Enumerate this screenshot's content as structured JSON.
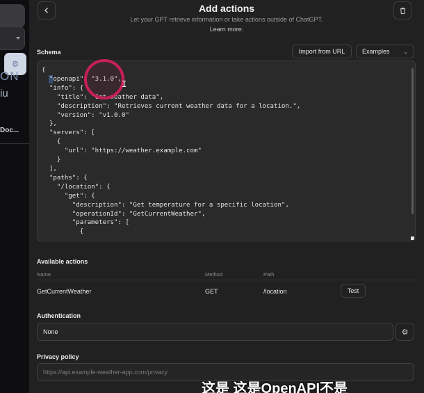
{
  "sidebar": {
    "fragment_1": "ON",
    "fragment_2": "iu",
    "fragment_3": "Doc..."
  },
  "header": {
    "title": "Add actions",
    "subtitle": "Let your GPT retrieve information or take actions outside of ChatGPT.",
    "learn_more": "Learn more."
  },
  "schema": {
    "label": "Schema",
    "import_label": "Import from URL",
    "examples_label": "Examples",
    "code": "{\n  \"openapi\": \"3.1.0\",\n  \"info\": {\n    \"title\": \"Get weather data\",\n    \"description\": \"Retrieves current weather data for a location.\",\n    \"version\": \"v1.0.0\"\n  },\n  \"servers\": [\n    {\n      \"url\": \"https://weather.example.com\"\n    }\n  ],\n  \"paths\": {\n    \"/location\": {\n      \"get\": {\n        \"description\": \"Get temperature for a specific location\",\n        \"operationId\": \"GetCurrentWeather\",\n        \"parameters\": [\n          {"
  },
  "actions": {
    "label": "Available actions",
    "columns": [
      "Name",
      "Method",
      "Path"
    ],
    "rows": [
      {
        "name": "GetCurrentWeather",
        "method": "GET",
        "path": "/location",
        "test_label": "Test"
      }
    ]
  },
  "authentication": {
    "label": "Authentication",
    "value": "None"
  },
  "privacy": {
    "label": "Privacy policy",
    "placeholder": "https://api.example-weather-app.com/privacy"
  },
  "video_subtitle": "这是  这是OpenAPI不是",
  "colors": {
    "background": "#212121",
    "editor_bg": "#2a2a2a",
    "cursor_ring": "#c71f5a",
    "border": "#3f3f44"
  },
  "icons": {
    "back": "chevron-left-icon",
    "trash": "trash-icon",
    "gear": "gear-icon",
    "dropdown": "chevron-down-icon"
  }
}
